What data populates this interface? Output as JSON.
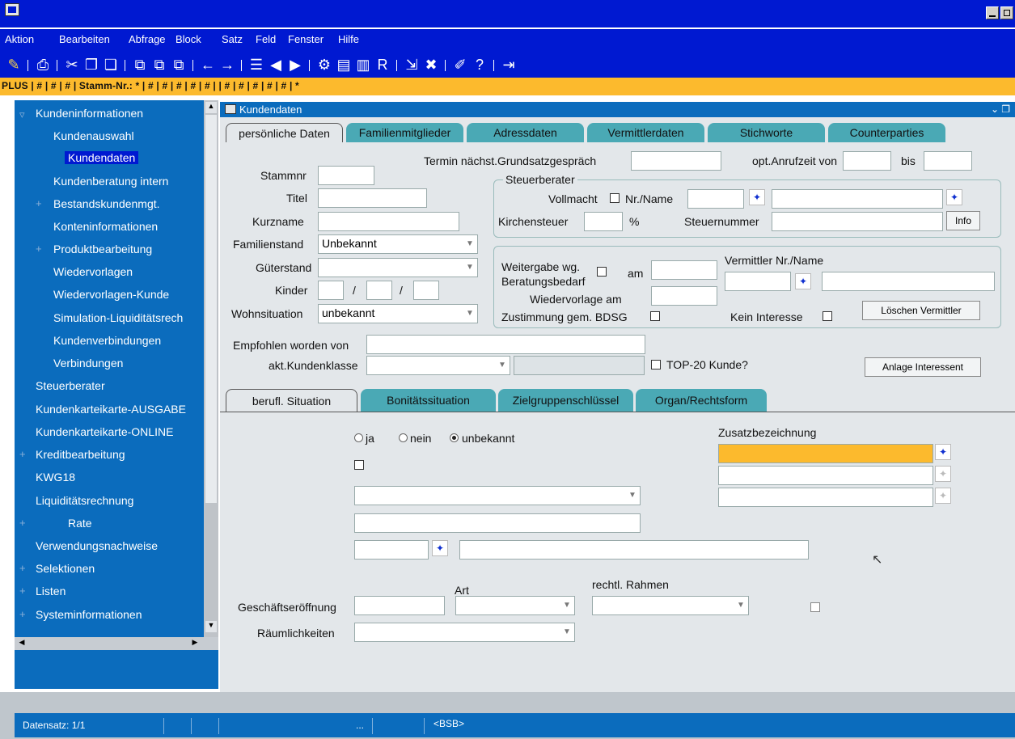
{
  "menubar": {
    "items": [
      "Aktion",
      "Bearbeiten",
      "Abfrage",
      "Block",
      "Satz",
      "Feld",
      "Fenster",
      "Hilfe"
    ]
  },
  "statusline": {
    "text": "PLUS | # | # | # | Stamm-Nr.: * | # | # | # | # | # | | # | # | # | # | # | *"
  },
  "nav": {
    "items": [
      {
        "label": "Kundeninformationen"
      },
      {
        "label": "Kundenauswahl"
      },
      {
        "label": "Kundendaten"
      },
      {
        "label": "Kundenberatung intern"
      },
      {
        "label": "Bestandskundenmgt."
      },
      {
        "label": "Konteninformationen"
      },
      {
        "label": "Produktbearbeitung"
      },
      {
        "label": "Wiedervorlagen"
      },
      {
        "label": "Wiedervorlagen-Kunde"
      },
      {
        "label": "Simulation-Liquiditätsrech"
      },
      {
        "label": "Kundenverbindungen"
      },
      {
        "label": "Verbindungen"
      },
      {
        "label": "Steuerberater"
      },
      {
        "label": "Kundenkarteikarte-AUSGABE"
      },
      {
        "label": "Kundenkarteikarte-ONLINE"
      },
      {
        "label": "Kreditbearbeitung"
      },
      {
        "label": "KWG18"
      },
      {
        "label": "Liquiditätsrechnung"
      },
      {
        "label": "Rate"
      },
      {
        "label": "Verwendungsnachweise"
      },
      {
        "label": "Selektionen"
      },
      {
        "label": "Listen"
      },
      {
        "label": "Systeminformationen"
      }
    ]
  },
  "panel": {
    "title": "Kundendaten"
  },
  "tabs_top": [
    "persönliche Daten",
    "Familienmitglieder",
    "Adressdaten",
    "Vermittlerdaten",
    "Stichworte",
    "Counterparties"
  ],
  "form": {
    "termin_label": "Termin nächst.Grundsatzgespräch",
    "anruf_label": "opt.Anrufzeit von",
    "bis_label": "bis",
    "stammnr_label": "Stammnr",
    "titel_label": "Titel",
    "kurzname_label": "Kurzname",
    "familienstand_label": "Familienstand",
    "familienstand_value": "Unbekannt",
    "gueterstand_label": "Güterstand",
    "kinder_label": "Kinder",
    "slash": "/",
    "wohnsituation_label": "Wohnsituation",
    "wohnsituation_value": "unbekannt",
    "steuerberater_title": "Steuerberater",
    "vollmacht_label": "Vollmacht",
    "nrname_label": "Nr./Name",
    "kirchensteuer_label": "Kirchensteuer",
    "percent": "%",
    "steuernummer_label": "Steuernummer",
    "info_button": "Info",
    "weitergabe_label": "Weitergabe wg.",
    "beratungsbedarf_label": "Beratungsbedarf",
    "am_label": "am",
    "vermittler_label": "Vermittler Nr./Name",
    "wiedervorlage_label": "Wiedervorlage am",
    "zustimmung_label": "Zustimmung gem. BDSG",
    "kein_interesse_label": "Kein Interesse",
    "loeschen_button": "Löschen Vermittler",
    "empfohlen_label": "Empfohlen worden von",
    "kundenklasse_label": "akt.Kundenklasse",
    "top20_label": "TOP-20 Kunde?",
    "anlage_button": "Anlage Interessent"
  },
  "tabs_bottom": [
    "berufl. Situation",
    "Bonitätssituation",
    "Zielgruppenschlüssel",
    "Organ/Rechtsform"
  ],
  "lower": {
    "ja": "ja",
    "nein": "nein",
    "unbekannt": "unbekannt",
    "zusatz_label": "Zusatzbezeichnung",
    "art_label": "Art",
    "rahmen_label": "rechtl. Rahmen",
    "eroeffnung_label": "Geschäftseröffnung",
    "raeume_label": "Räumlichkeiten"
  },
  "status": {
    "datensatz": "Datensatz: 1/1",
    "dots": "...",
    "bsb": "<BSB>"
  },
  "colors": {
    "title_blue": "#0019d1",
    "nav_blue": "#0b6cbd",
    "accent_yellow": "#fcba2d",
    "tab_teal": "#4aa9b5"
  }
}
